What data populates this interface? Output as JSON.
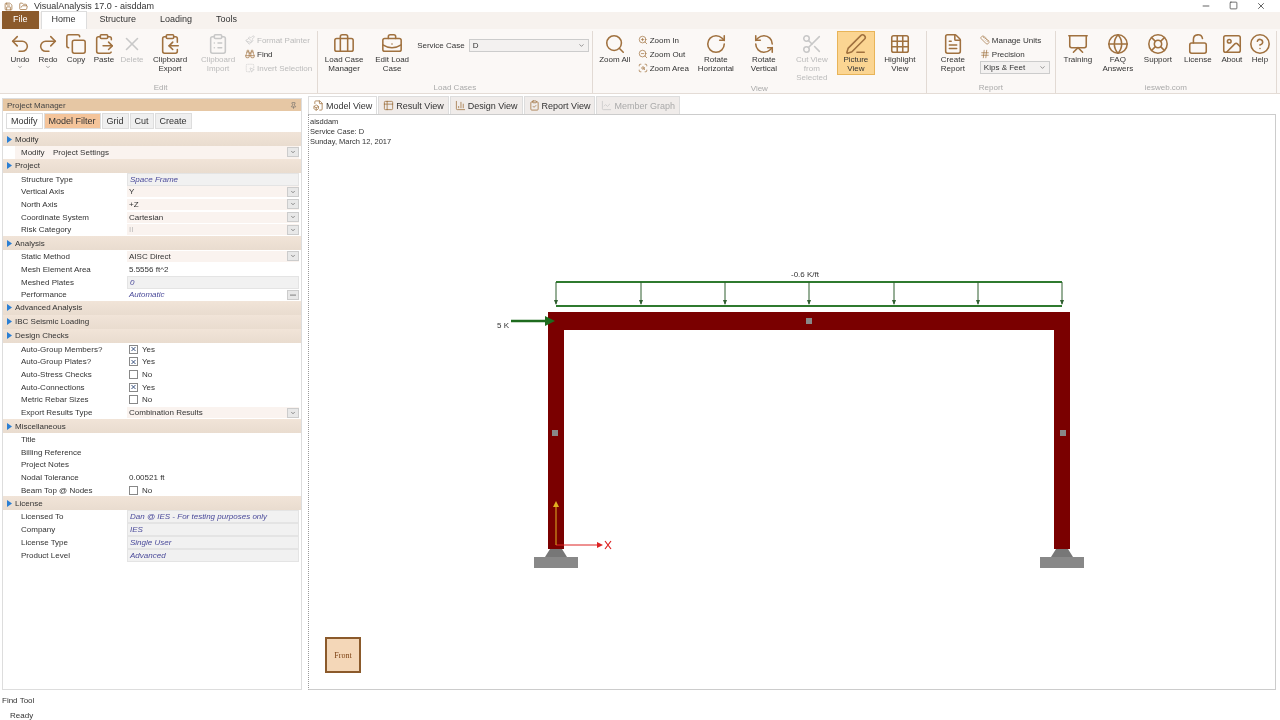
{
  "window": {
    "title": "VisualAnalysis 17.0 - aisddam"
  },
  "ribbon_tabs": [
    {
      "label": "File",
      "kind": "file",
      "selected": false
    },
    {
      "label": "Home",
      "kind": "tab",
      "selected": true
    },
    {
      "label": "Structure",
      "kind": "tab",
      "selected": false
    },
    {
      "label": "Loading",
      "kind": "tab",
      "selected": false
    },
    {
      "label": "Tools",
      "kind": "tab",
      "selected": false
    }
  ],
  "ribbon_groups": [
    {
      "name": "Edit",
      "items": [
        {
          "kind": "large",
          "label": "Undo",
          "disabled": false,
          "dropdown": true
        },
        {
          "kind": "large",
          "label": "Redo",
          "disabled": false,
          "dropdown": true
        },
        {
          "kind": "large",
          "label": "Copy",
          "disabled": false
        },
        {
          "kind": "large",
          "label": "Paste",
          "disabled": false
        },
        {
          "kind": "large",
          "label": "Delete",
          "disabled": true
        },
        {
          "kind": "large",
          "label": "Clipboard Export",
          "disabled": false
        },
        {
          "kind": "large",
          "label": "Clipboard Import",
          "disabled": true
        },
        {
          "kind": "stack",
          "items": [
            {
              "label": "Format Painter",
              "disabled": true
            },
            {
              "label": "Find",
              "disabled": false
            },
            {
              "label": "Invert Selection",
              "disabled": true
            }
          ]
        }
      ]
    },
    {
      "name": "Load Cases",
      "items": [
        {
          "kind": "large",
          "label": "Load Case Manager",
          "disabled": false
        },
        {
          "kind": "large",
          "label": "Edit Load Case",
          "disabled": false
        },
        {
          "kind": "combo",
          "label": "Service Case",
          "value": "D"
        }
      ]
    },
    {
      "name": "View",
      "items": [
        {
          "kind": "large",
          "label": "Zoom All",
          "disabled": false
        },
        {
          "kind": "stack",
          "items": [
            {
              "label": "Zoom In",
              "disabled": false
            },
            {
              "label": "Zoom Out",
              "disabled": false
            },
            {
              "label": "Zoom Area",
              "disabled": false
            }
          ]
        },
        {
          "kind": "large",
          "label": "Rotate Horizontal",
          "disabled": false
        },
        {
          "kind": "large",
          "label": "Rotate Vertical",
          "disabled": false
        },
        {
          "kind": "large",
          "label": "Cut View from Selected",
          "disabled": true
        },
        {
          "kind": "large",
          "label": "Picture View",
          "disabled": false,
          "selected": true
        },
        {
          "kind": "large",
          "label": "Highlight View",
          "disabled": false,
          "selected": false
        }
      ]
    },
    {
      "name": "Report",
      "items": [
        {
          "kind": "large",
          "label": "Create Report",
          "disabled": false
        },
        {
          "kind": "stack",
          "items": [
            {
              "label": "Manage Units",
              "disabled": false
            },
            {
              "label": "Precision",
              "disabled": false
            }
          ],
          "combo": "Kips & Feet"
        }
      ]
    },
    {
      "name": "iesweb.com",
      "items": [
        {
          "kind": "large",
          "label": "Training",
          "disabled": false
        },
        {
          "kind": "large",
          "label": "FAQ Answers",
          "disabled": false
        },
        {
          "kind": "large",
          "label": "Support",
          "disabled": false
        },
        {
          "kind": "large",
          "label": "License",
          "disabled": false
        },
        {
          "kind": "large",
          "label": "About",
          "disabled": false
        },
        {
          "kind": "large",
          "label": "Help",
          "disabled": false
        }
      ]
    }
  ],
  "project_manager": {
    "title": "Project Manager",
    "tabs": [
      {
        "label": "Modify",
        "selected": true,
        "hovered": false
      },
      {
        "label": "Model Filter",
        "selected": false,
        "hovered": true
      },
      {
        "label": "Grid",
        "selected": false,
        "hovered": false
      },
      {
        "label": "Cut",
        "selected": false,
        "hovered": false
      },
      {
        "label": "Create",
        "selected": false,
        "hovered": false
      }
    ],
    "sections": [
      {
        "title": "Modify",
        "expanded": true,
        "rows": [
          {
            "kind": "modify",
            "label": "Modify",
            "value": "Project Settings"
          }
        ]
      },
      {
        "title": "Project",
        "expanded": true,
        "rows": [
          {
            "kind": "readonly",
            "label": "Structure Type",
            "value": "Space Frame"
          },
          {
            "kind": "dropdown",
            "label": "Vertical Axis",
            "value": "Y"
          },
          {
            "kind": "dropdown",
            "label": "North Axis",
            "value": "+Z"
          },
          {
            "kind": "dropdown",
            "label": "Coordinate System",
            "value": "Cartesian"
          },
          {
            "kind": "dropdown",
            "label": "Risk Category",
            "value": "II",
            "disabled": true
          }
        ]
      },
      {
        "title": "Analysis",
        "expanded": true,
        "rows": [
          {
            "kind": "dropdown",
            "label": "Static Method",
            "value": "AISC Direct"
          },
          {
            "kind": "text",
            "label": "Mesh Element Area",
            "value": "5.5556 ft^2"
          },
          {
            "kind": "readonly",
            "label": "Meshed Plates",
            "value": "0"
          },
          {
            "kind": "button",
            "label": "Performance",
            "value": "Automatic"
          }
        ]
      },
      {
        "title": "Advanced Analysis",
        "expanded": false
      },
      {
        "title": "IBC Seismic Loading",
        "expanded": false
      },
      {
        "title": "Design Checks",
        "expanded": true,
        "rows": [
          {
            "kind": "checkbox",
            "label": "Auto-Group Members?",
            "checked": true,
            "value": "Yes"
          },
          {
            "kind": "checkbox",
            "label": "Auto-Group Plates?",
            "checked": true,
            "value": "Yes"
          },
          {
            "kind": "checkbox",
            "label": "Auto-Stress Checks",
            "checked": false,
            "value": "No"
          },
          {
            "kind": "checkbox",
            "label": "Auto-Connections",
            "checked": true,
            "value": "Yes"
          },
          {
            "kind": "checkbox",
            "label": "Metric Rebar Sizes",
            "checked": false,
            "value": "No"
          },
          {
            "kind": "dropdown",
            "label": "Export Results Type",
            "value": "Combination Results"
          }
        ]
      },
      {
        "title": "Miscellaneous",
        "expanded": true,
        "rows": [
          {
            "kind": "text",
            "label": "Title"
          },
          {
            "kind": "text",
            "label": "Billing Reference"
          },
          {
            "kind": "text",
            "label": "Project Notes"
          },
          {
            "kind": "text",
            "label": "Nodal Tolerance",
            "value": "0.00521 ft"
          },
          {
            "kind": "checkbox",
            "label": "Beam Top @ Nodes",
            "checked": false,
            "value": "No"
          }
        ]
      },
      {
        "title": "License",
        "expanded": true,
        "rows": [
          {
            "kind": "readonly",
            "label": "Licensed To",
            "value": "Dan @ IES - For testing purposes only"
          },
          {
            "kind": "readonly",
            "label": "Company",
            "value": "IES"
          },
          {
            "kind": "readonly",
            "label": "License Type",
            "value": "Single User"
          },
          {
            "kind": "readonly",
            "label": "Product Level",
            "value": "Advanced"
          }
        ]
      }
    ]
  },
  "view_tabs": [
    {
      "label": "Model View",
      "selected": true,
      "disabled": false
    },
    {
      "label": "Result View",
      "selected": false,
      "disabled": false
    },
    {
      "label": "Design View",
      "selected": false,
      "disabled": false
    },
    {
      "label": "Report View",
      "selected": false,
      "disabled": false
    },
    {
      "label": "Member Graph",
      "selected": false,
      "disabled": true
    }
  ],
  "canvas": {
    "header": [
      "aisddam",
      "Service Case: D",
      "Sunday, March 12, 2017"
    ],
    "distributed_load": "-0.6 K/ft",
    "point_load": "5 K",
    "view_cube": "Front"
  },
  "status_bar": {
    "find_tool": "Find Tool",
    "status": "Ready"
  }
}
